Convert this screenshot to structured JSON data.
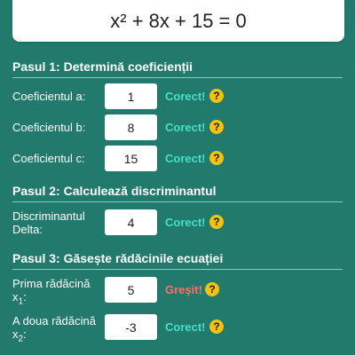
{
  "equation": "x² + 8x + 15 = 0",
  "colors": {
    "background": "#217a6b",
    "correct": "#44e0c7",
    "wrong": "#ff6e6e",
    "help": "#f4c20d"
  },
  "help_icon_glyph": "?",
  "steps": [
    {
      "title": "Pasul 1: Determină coeficienții",
      "rows": [
        {
          "label": "Coeficientul a:",
          "value": "1",
          "status": "Corect!"
        },
        {
          "label": "Coeficientul b:",
          "value": "8",
          "status": "Corect!"
        },
        {
          "label": "Coeficientul c:",
          "value": "15",
          "status": "Corect!"
        }
      ]
    },
    {
      "title": "Pasul 2: Calculează discriminantul",
      "rows": [
        {
          "label": "Discriminantul Delta:",
          "value": "4",
          "status": "Corect!"
        }
      ]
    },
    {
      "title": "Pasul 3: Găsește rădăcinile ecuației",
      "rows": [
        {
          "label": "Prima rădăcină",
          "label_sub_prefix": "x",
          "label_sub": "1",
          "label_suffix": ":",
          "value": "5",
          "status": "Greșit!"
        },
        {
          "label": "A doua rădăcină",
          "label_sub_prefix": "x",
          "label_sub": "2",
          "label_suffix": ":",
          "value": "-3",
          "status": "Corect!"
        }
      ]
    }
  ]
}
